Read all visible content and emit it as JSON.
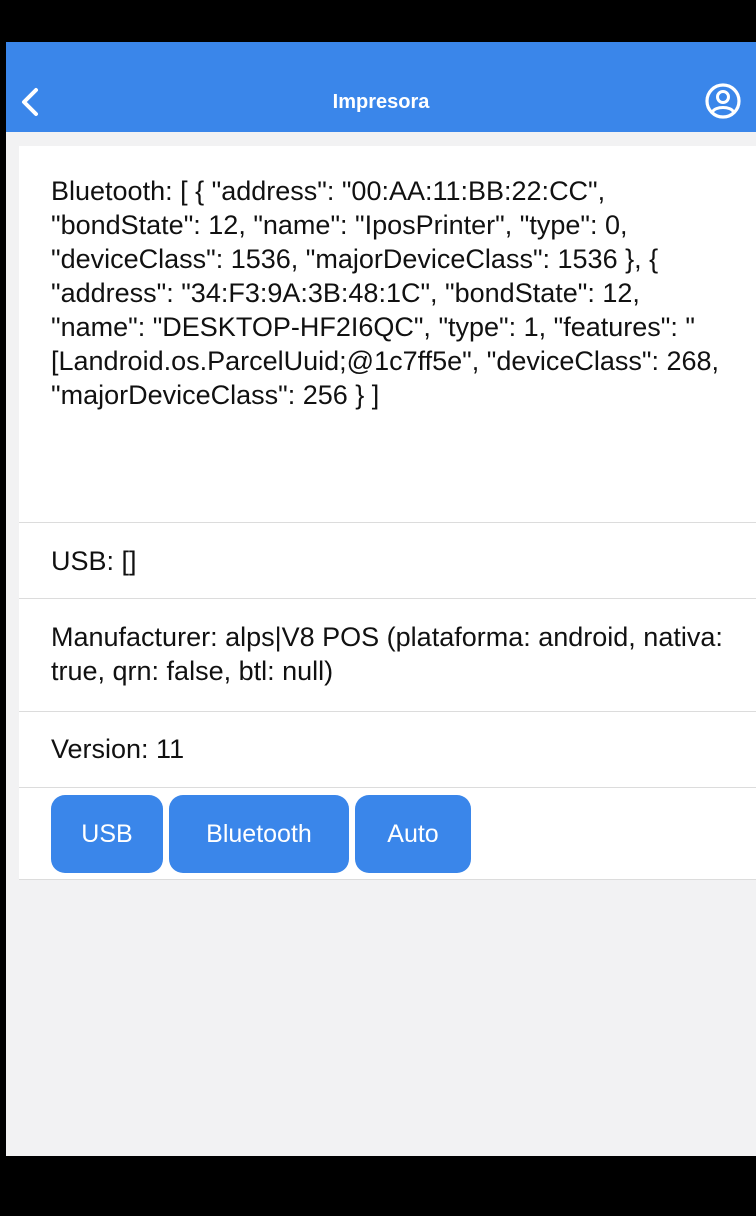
{
  "header": {
    "title": "Impresora",
    "back_icon": "chevron-left-icon",
    "profile_icon": "user-circle-icon"
  },
  "info": {
    "bluetooth": "Bluetooth: [ { \"address\": \"00:AA:11:BB:22:CC\", \"bondState\": 12, \"name\": \"IposPrinter\", \"type\": 0, \"deviceClass\": 1536, \"majorDeviceClass\": 1536 }, { \"address\": \"34:F3:9A:3B:48:1C\", \"bondState\": 12, \"name\": \"DESKTOP-HF2I6QC\", \"type\": 1, \"features\": \"[Landroid.os.ParcelUuid;@1c7ff5e\", \"deviceClass\": 268, \"majorDeviceClass\": 256 } ]",
    "usb": "USB: []",
    "manufacturer": "Manufacturer: alps|V8 POS (plataforma: android, nativa: true, qrn: false, btl: null)",
    "version": "Version: 11"
  },
  "buttons": {
    "usb": "USB",
    "bluetooth": "Bluetooth",
    "auto": "Auto"
  },
  "colors": {
    "primary": "#3a86ea",
    "background": "#f2f2f3",
    "card": "#ffffff"
  }
}
